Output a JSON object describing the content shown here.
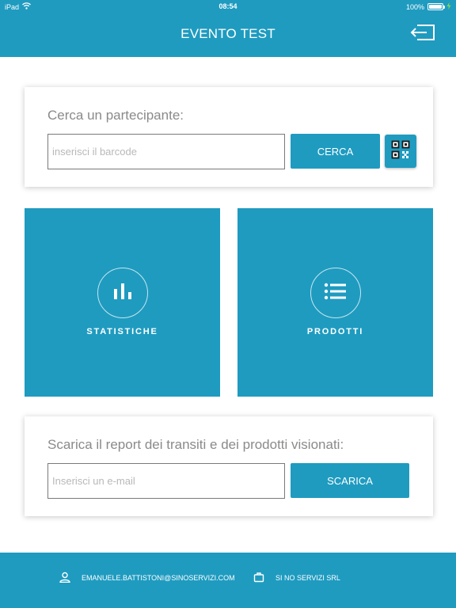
{
  "status_bar": {
    "device": "iPad",
    "time": "08:54",
    "battery": "100%",
    "battery_level": 1.0
  },
  "header": {
    "title": "EVENTO TEST",
    "logout_icon": "logout-icon"
  },
  "search": {
    "title": "Cerca un partecipante:",
    "placeholder": "inserisci il barcode",
    "value": "",
    "button_label": "CERCA",
    "qr_icon": "qr-code-icon"
  },
  "tiles": {
    "stats": {
      "label": "STATISTICHE",
      "icon": "bar-chart-icon"
    },
    "products": {
      "label": "PRODOTTI",
      "icon": "list-icon"
    }
  },
  "report": {
    "title": "Scarica il report dei transiti e dei prodotti visionati:",
    "placeholder": "Inserisci un e-mail",
    "value": "",
    "button_label": "SCARICA"
  },
  "footer": {
    "user_email": "EMANUELE.BATTISTONI@SINOSERVIZI.COM",
    "company": "SI NO SERVIZI SRL"
  },
  "colors": {
    "accent": "#1f9bc0",
    "background": "#ffffff",
    "title_text": "#8a8a8a"
  }
}
